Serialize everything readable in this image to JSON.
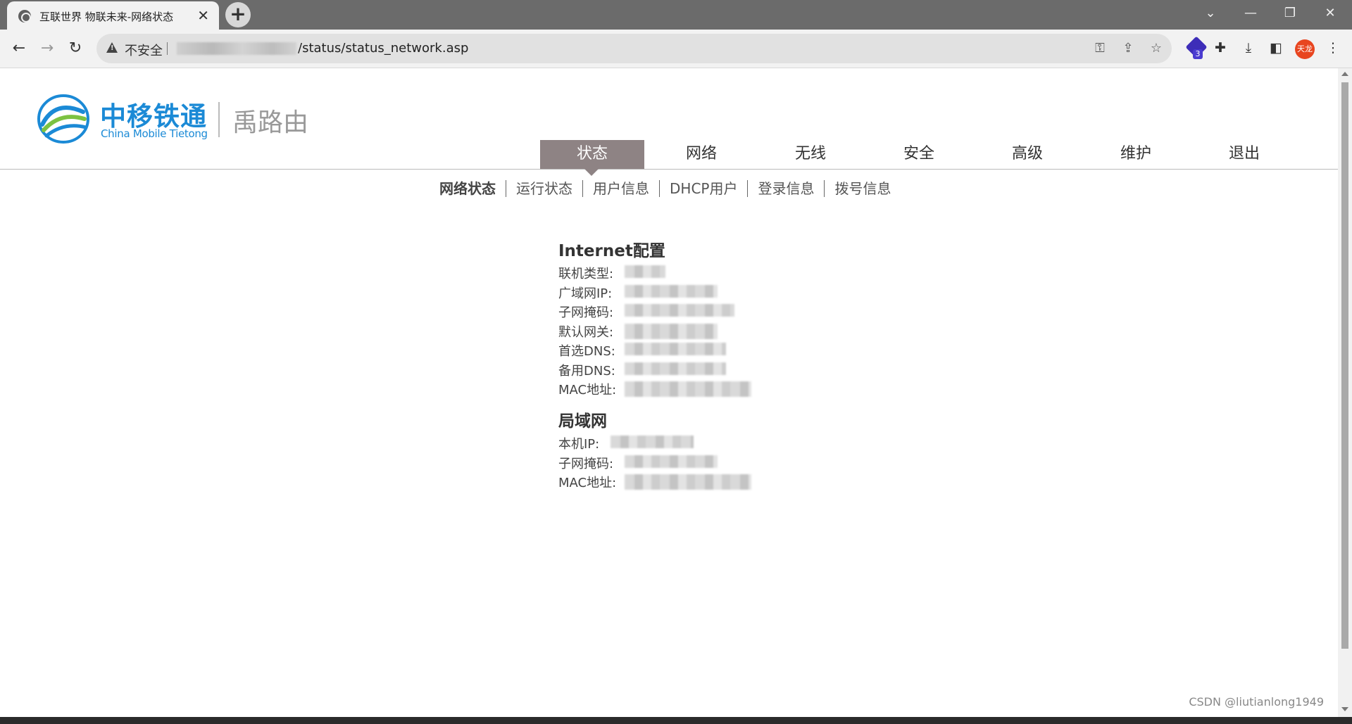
{
  "browser": {
    "tab_title": "互联世界 物联未来-网络状态",
    "tab_close": "✕",
    "new_tab": "+",
    "insecure_label": "不安全",
    "url_path": "/status/status_network.asp",
    "extension_badge_count": "3",
    "profile_label": "天龙"
  },
  "logo": {
    "name_cn": "中移铁通",
    "name_en": "China Mobile Tietong",
    "brand": "禹路由"
  },
  "main_nav": {
    "items": [
      {
        "label": "状态",
        "active": true
      },
      {
        "label": "网络",
        "active": false
      },
      {
        "label": "无线",
        "active": false
      },
      {
        "label": "安全",
        "active": false
      },
      {
        "label": "高级",
        "active": false
      },
      {
        "label": "维护",
        "active": false
      },
      {
        "label": "退出",
        "active": false
      }
    ]
  },
  "sub_nav": {
    "items": [
      {
        "label": "网络状态",
        "active": true
      },
      {
        "label": "运行状态",
        "active": false
      },
      {
        "label": "用户信息",
        "active": false
      },
      {
        "label": "DHCP用户",
        "active": false
      },
      {
        "label": "登录信息",
        "active": false
      },
      {
        "label": "拨号信息",
        "active": false
      }
    ]
  },
  "internet": {
    "title": "Internet配置",
    "rows": [
      {
        "label": "联机类型:"
      },
      {
        "label": "广域网IP:"
      },
      {
        "label": "子网掩码:"
      },
      {
        "label": "默认网关:"
      },
      {
        "label": "首选DNS:"
      },
      {
        "label": "备用DNS:"
      },
      {
        "label": "MAC地址:"
      }
    ]
  },
  "lan": {
    "title": "局域网",
    "rows": [
      {
        "label": "本机IP:"
      },
      {
        "label": "子网掩码:"
      },
      {
        "label": "MAC地址:"
      }
    ]
  },
  "watermark": "CSDN @liutianlong1949",
  "colors": {
    "brand_blue": "#1b8ad6",
    "nav_active_bg": "#8e8384",
    "logo_green": "#7cc242"
  }
}
